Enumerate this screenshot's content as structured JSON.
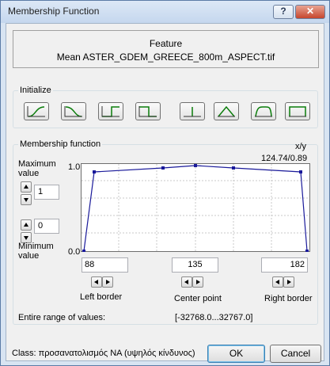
{
  "window": {
    "title": "Membership Function",
    "help_label": "?",
    "close_label": "✕"
  },
  "feature": {
    "heading": "Feature",
    "name": "Mean ASTER_GDEM_GREECE_800m_ASPECT.tif"
  },
  "initialize": {
    "label": "Initialize",
    "shapes": [
      "s-curve-rising",
      "s-curve-falling",
      "step-rising",
      "step-falling",
      "singleton",
      "triangle",
      "trapezoid",
      "full-range"
    ]
  },
  "membership": {
    "label": "Membership function",
    "xy_label": "x/y",
    "xy_value": "124.74/0.89",
    "max_label_line1": "Maximum",
    "max_label_line2": "value",
    "max_value": "1",
    "min_value": "0",
    "min_label_line1": "Minimum",
    "min_label_line2": "value",
    "y_top_label": "1.0",
    "y_bottom_label": "0.0",
    "left_border_value": "88",
    "center_point_value": "135",
    "right_border_value": "182",
    "left_border_label": "Left border",
    "center_point_label": "Center point",
    "right_border_label": "Right border",
    "range_label": "Entire range of values:",
    "range_value": "[-32768.0...32767.0]"
  },
  "footer": {
    "class_label": "Class: προσανατολισμός ΝΑ (υψηλός κίνδυνος)",
    "ok_label": "OK",
    "cancel_label": "Cancel"
  },
  "colors": {
    "curve": "#1a1a9a",
    "points": "#1a1a9a",
    "window_frame": "#d8e4f2"
  }
}
